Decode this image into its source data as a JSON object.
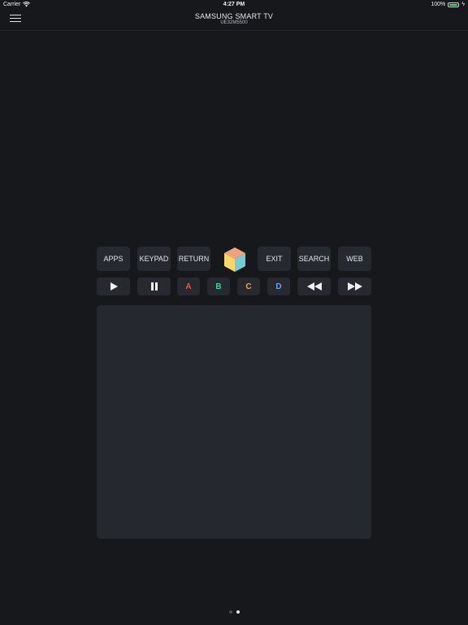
{
  "status_bar": {
    "carrier": "Carrier",
    "time": "4:27 PM",
    "battery": "100%",
    "battery_color": "#4cd964"
  },
  "nav": {
    "title": "SAMSUNG SMART TV",
    "subtitle": "UE32M5500"
  },
  "remote": {
    "top_row": [
      "APPS",
      "KEYPAD",
      "RETURN",
      "EXIT",
      "SEARCH",
      "WEB"
    ],
    "media_row": {
      "play_icon": "play-icon",
      "pause_icon": "pause-icon",
      "rewind_icon": "rewind-icon",
      "fast_forward_icon": "fast-forward-icon"
    },
    "color_buttons": [
      {
        "label": "A",
        "color": "#e05a4f"
      },
      {
        "label": "B",
        "color": "#3fcf9f"
      },
      {
        "label": "C",
        "color": "#f0a83a"
      },
      {
        "label": "D",
        "color": "#6f9fe8"
      }
    ],
    "smart_hub_icon": "cube-icon"
  },
  "pager": {
    "pages": 2,
    "active": 2
  }
}
